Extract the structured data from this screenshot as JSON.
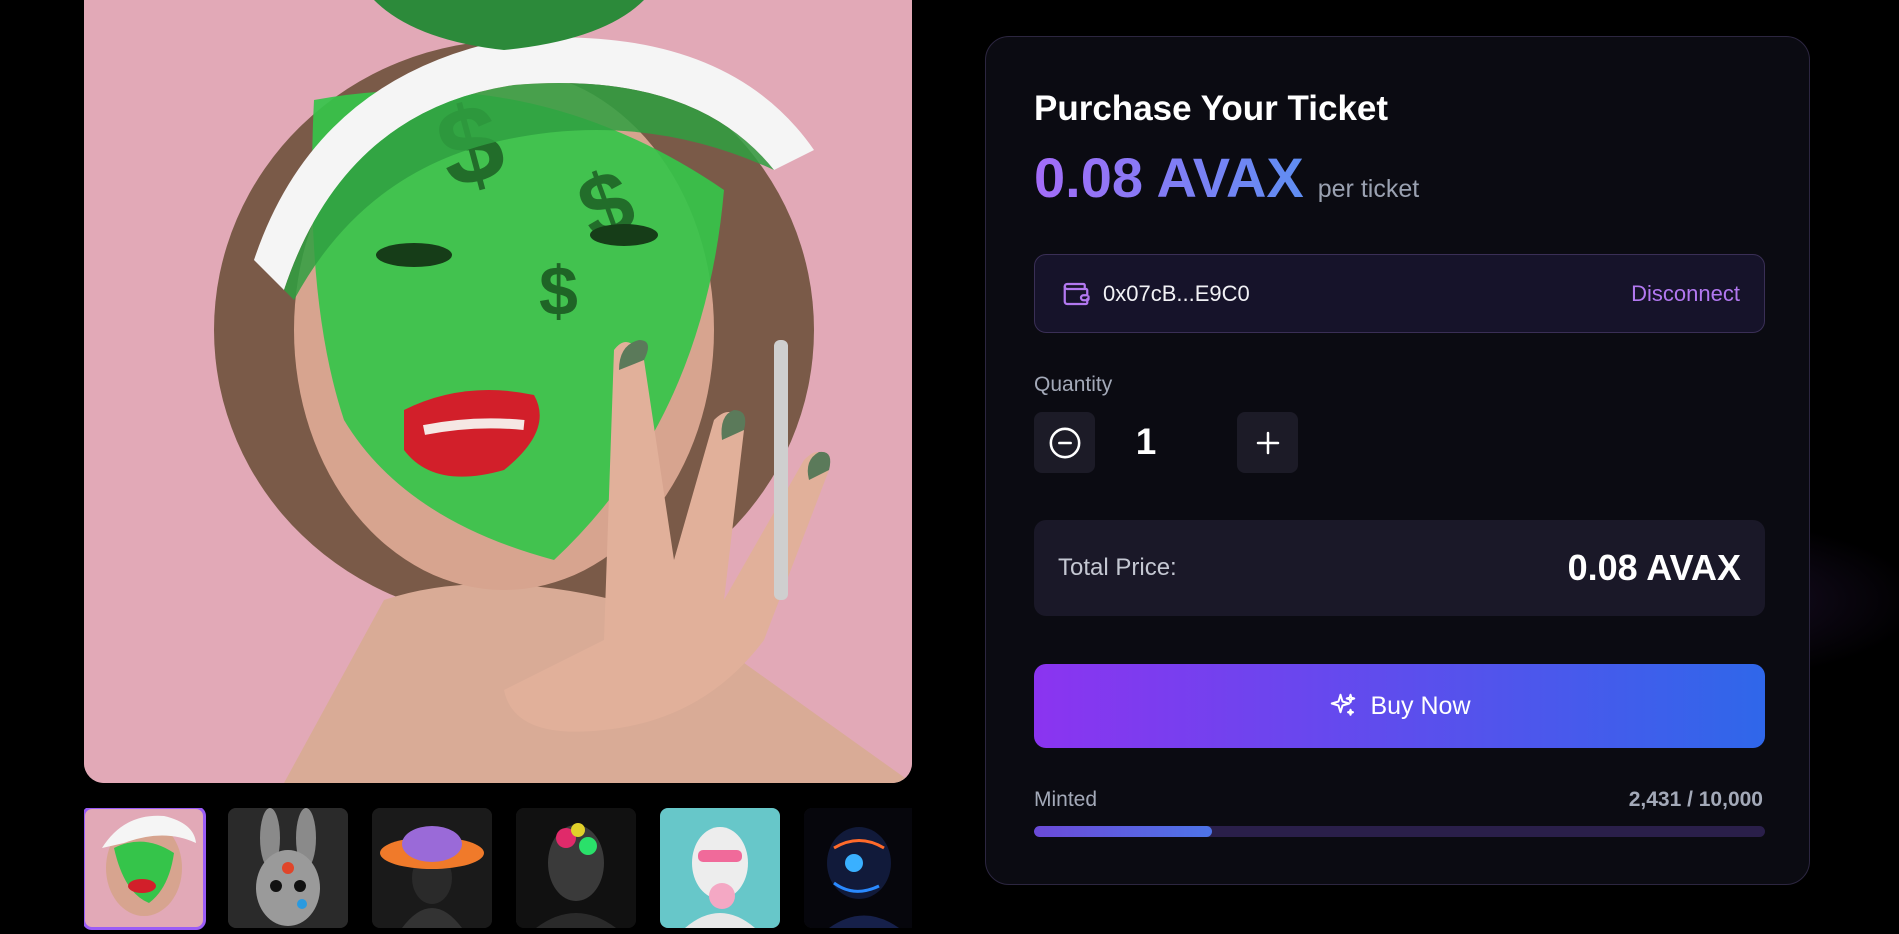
{
  "gallery": {
    "main_image": "woman-green-dollar-visor-artwork",
    "thumbnails": [
      {
        "name": "woman-green-dollar-visor",
        "selected": true
      },
      {
        "name": "graffiti-rabbit-mask",
        "selected": false
      },
      {
        "name": "bucket-hat-figure",
        "selected": false
      },
      {
        "name": "painted-helmet-figure",
        "selected": false
      },
      {
        "name": "bubblegum-statue",
        "selected": false
      },
      {
        "name": "neon-robot-head",
        "selected": false
      }
    ]
  },
  "purchase": {
    "title": "Purchase Your Ticket",
    "price": "0.08 AVAX",
    "price_unit": "per ticket",
    "wallet": {
      "icon": "wallet-icon",
      "address": "0x07cB...E9C0",
      "disconnect_label": "Disconnect"
    },
    "quantity": {
      "label": "Quantity",
      "value": "1",
      "decrement_icon": "minus-circle-icon",
      "increment_icon": "plus-icon"
    },
    "total": {
      "label": "Total Price:",
      "value": "0.08 AVAX"
    },
    "buy": {
      "label": "Buy Now",
      "icon": "sparkles-icon"
    },
    "minted": {
      "label": "Minted",
      "count": "2,431 / 10,000",
      "fraction": 0.2431
    }
  },
  "colors": {
    "accent_purple": "#9b5cf6",
    "accent_blue": "#2f67ea",
    "card_bg": "#0b0b12"
  }
}
